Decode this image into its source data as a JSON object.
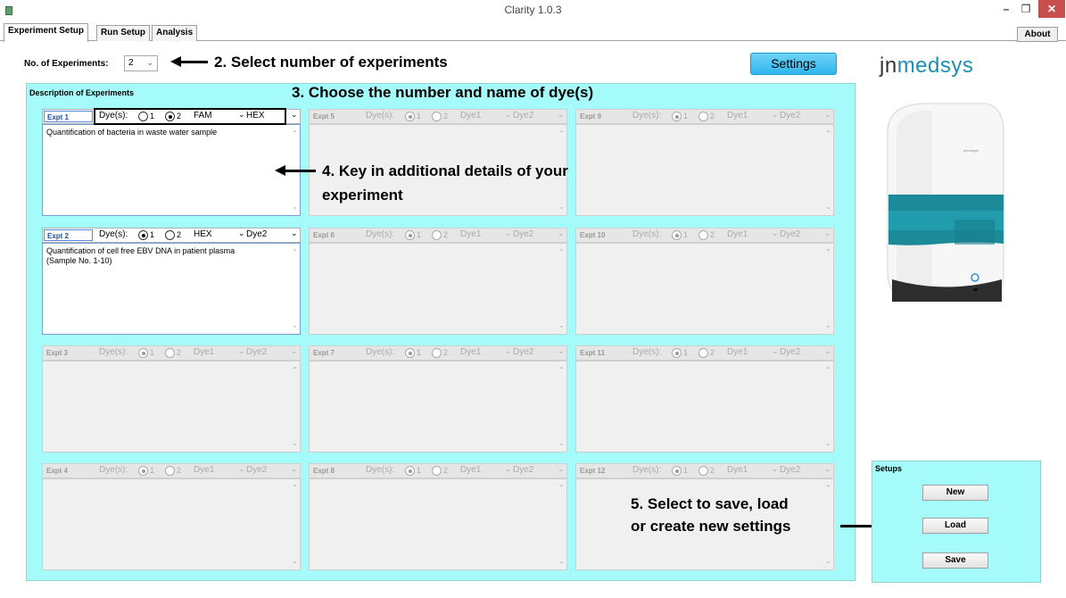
{
  "window": {
    "title": "Clarity 1.0.3",
    "minimize": "–",
    "restore": "❐",
    "close": "✕"
  },
  "tabs": [
    {
      "label": "Experiment Setup"
    },
    {
      "label": "Run Setup"
    },
    {
      "label": "Analysis"
    }
  ],
  "about_label": "About",
  "num_experiments": {
    "label": "No. of Experiments:",
    "value": "2"
  },
  "settings_label": "Settings",
  "logo": {
    "prefix": "jn",
    "accent": "medsys"
  },
  "instrument_label": "jnmedsys",
  "description_panel": {
    "title": "Description of Experiments"
  },
  "annotations": {
    "a2": "2. Select number of experiments",
    "a3": "3. Choose the number and name of dye(s)",
    "a4_line1": "4. Key in additional details of your",
    "a4_line2": "experiment",
    "a5_line1": "5. Select to save, load",
    "a5_line2": "or create new settings"
  },
  "dye_label": "Dye(s):",
  "radio_1": "1",
  "radio_2": "2",
  "experiments": [
    {
      "name": "Expt 1",
      "dye_count": 2,
      "dye1": "FAM",
      "dye2": "HEX",
      "text": "Quantification of bacteria in waste water sample"
    },
    {
      "name": "Expt 2",
      "dye_count": 1,
      "dye1": "HEX",
      "dye2": "Dye2",
      "text": "Quantification of cell free EBV DNA in patient plasma\n(Sample No. 1-10)"
    },
    {
      "name": "Expt 3",
      "dye_count": 1,
      "dye1": "Dye1",
      "dye2": "Dye2",
      "text": ""
    },
    {
      "name": "Expt 4",
      "dye_count": 1,
      "dye1": "Dye1",
      "dye2": "Dye2",
      "text": ""
    },
    {
      "name": "Expt 5",
      "dye_count": 1,
      "dye1": "Dye1",
      "dye2": "Dye2",
      "text": ""
    },
    {
      "name": "Expt 6",
      "dye_count": 1,
      "dye1": "Dye1",
      "dye2": "Dye2",
      "text": ""
    },
    {
      "name": "Expt 7",
      "dye_count": 1,
      "dye1": "Dye1",
      "dye2": "Dye2",
      "text": ""
    },
    {
      "name": "Expt 8",
      "dye_count": 1,
      "dye1": "Dye1",
      "dye2": "Dye2",
      "text": ""
    },
    {
      "name": "Expt 9",
      "dye_count": 1,
      "dye1": "Dye1",
      "dye2": "Dye2",
      "text": ""
    },
    {
      "name": "Expt 10",
      "dye_count": 1,
      "dye1": "Dye1",
      "dye2": "Dye2",
      "text": ""
    },
    {
      "name": "Expt 11",
      "dye_count": 1,
      "dye1": "Dye1",
      "dye2": "Dye2",
      "text": ""
    },
    {
      "name": "Expt 12",
      "dye_count": 1,
      "dye1": "Dye1",
      "dye2": "Dye2",
      "text": ""
    }
  ],
  "setups": {
    "title": "Setups",
    "new_label": "New",
    "load_label": "Load",
    "save_label": "Save"
  },
  "colors": {
    "panel_bg": "#a5fbf9",
    "settings_btn": "#2fb6ec",
    "logo_accent": "#1b8fb2",
    "close_btn": "#c7504f"
  }
}
